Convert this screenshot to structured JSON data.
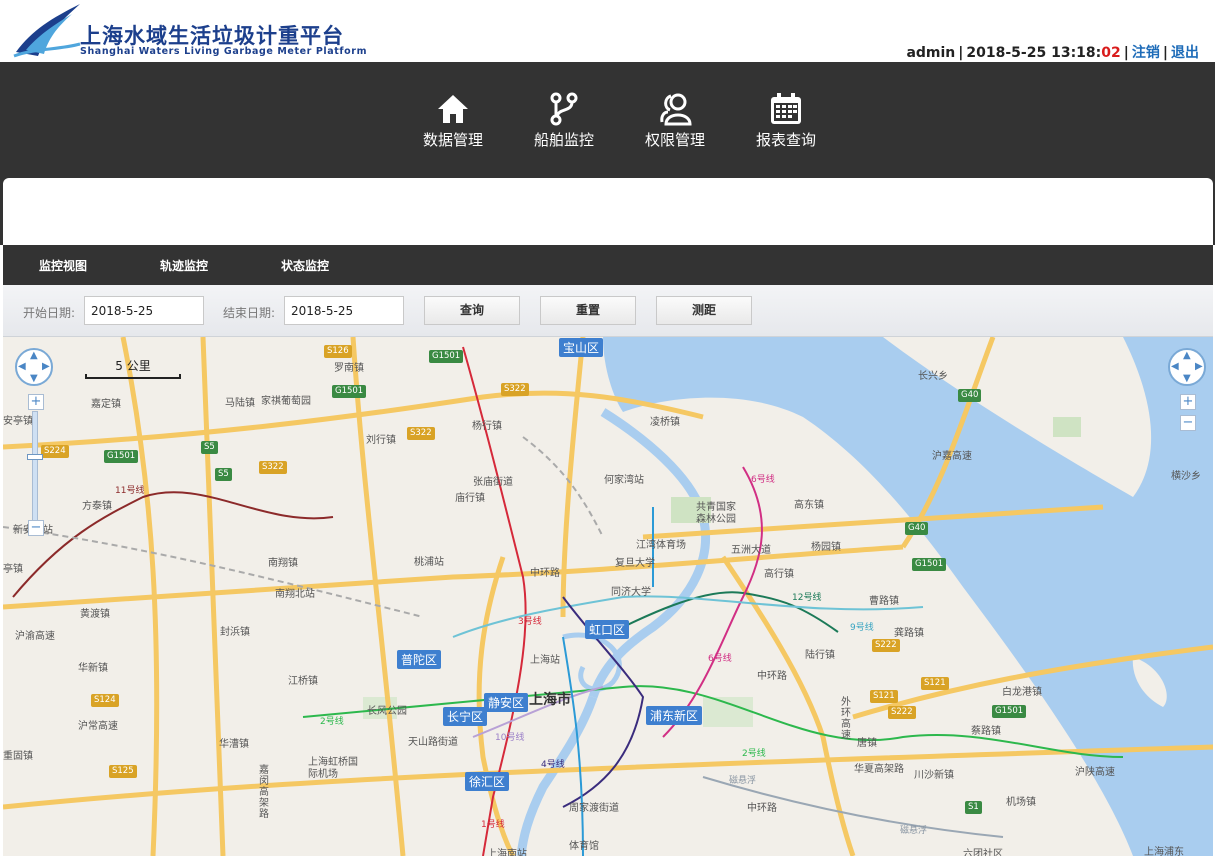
{
  "header": {
    "brand_cn": "上海水域生活垃圾计重平台",
    "brand_en": "Shanghai Waters Living Garbage Meter Platform",
    "user": "admin",
    "datetime": "2018-5-25 13:18:",
    "seconds": "02",
    "logout": "注销",
    "exit": "退出"
  },
  "mainnav": {
    "items": [
      {
        "label": "数据管理",
        "icon": "home-icon"
      },
      {
        "label": "船舶监控",
        "icon": "branch-icon"
      },
      {
        "label": "权限管理",
        "icon": "users-icon"
      },
      {
        "label": "报表查询",
        "icon": "calendar-icon"
      }
    ]
  },
  "subnav": {
    "items": [
      {
        "label": "监控视图"
      },
      {
        "label": "轨迹监控"
      },
      {
        "label": "状态监控"
      }
    ]
  },
  "query": {
    "start_label": "开始日期:",
    "start_value": "2018-5-25",
    "end_label": "结束日期:",
    "end_value": "2018-5-25",
    "search": "查询",
    "reset": "重置",
    "measure": "测距"
  },
  "map": {
    "scale": "5 公里",
    "city": "上海市",
    "districts": [
      "宝山区",
      "虹口区",
      "普陀区",
      "静安区",
      "长宁区",
      "浦东新区",
      "徐汇区"
    ],
    "towns": [
      "罗南镇",
      "马陆镇",
      "家祺葡萄园",
      "嘉定镇",
      "杨行镇",
      "刘行镇",
      "凌桥镇",
      "长兴乡",
      "横沙乡",
      "张庙街道",
      "庙行镇",
      "何家湾站",
      "方泰镇",
      "共青国家森林公园",
      "高东镇",
      "江湾体育场",
      "五洲大道",
      "杨园镇",
      "南翔镇",
      "桃浦站",
      "复旦大学",
      "同济大学",
      "高行镇",
      "南翔北站",
      "曹路镇",
      "黄渡镇",
      "封浜镇",
      "龚路镇",
      "上海站",
      "陆行镇",
      "华新镇",
      "江桥镇",
      "长风公园",
      "白龙港镇",
      "天山路街道",
      "华漕镇",
      "唐镇",
      "蔡路镇",
      "上海虹桥国际机场",
      "川沙新镇",
      "周家渡街道",
      "机场镇",
      "体育馆",
      "上海南站",
      "六团社区",
      "上海浦东",
      "安亭镇",
      "重固镇",
      "新安亭站",
      "亭镇"
    ],
    "roads": [
      "S126",
      "G1501",
      "S322",
      "G1501",
      "S322",
      "S5",
      "S5",
      "S224",
      "G1501",
      "S322",
      "G40",
      "G40",
      "G1501",
      "S222",
      "S121",
      "S121",
      "S222",
      "G1501",
      "S1",
      "S124",
      "S125"
    ],
    "roadnames": [
      "中环路",
      "五洲大道",
      "沪嘉高速",
      "沪常高速",
      "沪渝高速",
      "中环路",
      "华夏高架路",
      "外环高速",
      "中环路",
      "嘉闵高架路",
      "沪陕高速"
    ],
    "metro": [
      "11号线",
      "6号线",
      "12号线",
      "9号线",
      "3号线",
      "6号线",
      "2号线",
      "10号线",
      "4号线",
      "2号线",
      "1号线",
      "磁悬浮",
      "磁悬浮"
    ]
  }
}
